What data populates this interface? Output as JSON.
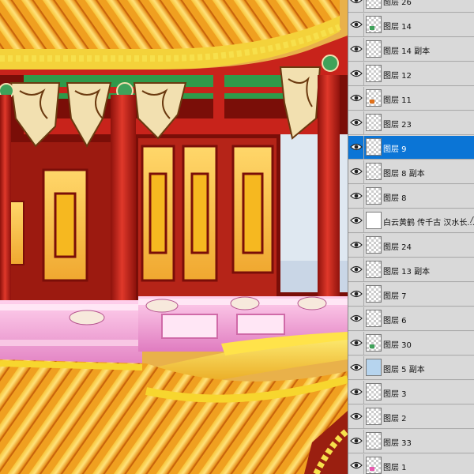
{
  "app": {
    "name": "Photoshop",
    "panel": "Layers"
  },
  "layers": [
    {
      "name": "图层 26",
      "visible": true,
      "selected": false,
      "thumb": "blank"
    },
    {
      "name": "图层 14",
      "visible": true,
      "selected": false,
      "thumb": "green"
    },
    {
      "name": "图层 14 副本",
      "visible": true,
      "selected": false,
      "thumb": "blank"
    },
    {
      "name": "图层 12",
      "visible": true,
      "selected": false,
      "thumb": "blank"
    },
    {
      "name": "图层 11",
      "visible": true,
      "selected": false,
      "thumb": "orange"
    },
    {
      "name": "图层 23",
      "visible": true,
      "selected": false,
      "thumb": "blank"
    },
    {
      "name": "图层 9",
      "visible": true,
      "selected": true,
      "thumb": "blank"
    },
    {
      "name": "图层 8 副本",
      "visible": true,
      "selected": false,
      "thumb": "blank"
    },
    {
      "name": "图层 8",
      "visible": true,
      "selected": false,
      "thumb": "blank"
    },
    {
      "name": "白云黄鹤 传千古 汉水长...",
      "visible": true,
      "selected": false,
      "thumb": "text",
      "fx": "/"
    },
    {
      "name": "图层 24",
      "visible": true,
      "selected": false,
      "thumb": "blank"
    },
    {
      "name": "图层 13 副本",
      "visible": true,
      "selected": false,
      "thumb": "blank"
    },
    {
      "name": "图层 7",
      "visible": true,
      "selected": false,
      "thumb": "blank"
    },
    {
      "name": "图层 6",
      "visible": true,
      "selected": false,
      "thumb": "blank"
    },
    {
      "name": "图层 30",
      "visible": true,
      "selected": false,
      "thumb": "green"
    },
    {
      "name": "图层 5 副本",
      "visible": true,
      "selected": false,
      "thumb": "sky"
    },
    {
      "name": "图层 3",
      "visible": true,
      "selected": false,
      "thumb": "blank"
    },
    {
      "name": "图层 2",
      "visible": true,
      "selected": false,
      "thumb": "blank"
    },
    {
      "name": "图层 33",
      "visible": true,
      "selected": false,
      "thumb": "blank"
    },
    {
      "name": "图层 1",
      "visible": true,
      "selected": false,
      "thumb": "pink"
    }
  ],
  "colors": {
    "selected_row": "#0b75d6",
    "roof_tile": "#f2a41c",
    "pillar_red": "#c8231b",
    "railing_pink": "#f3a6d4",
    "beam_green": "#2f9a4a"
  }
}
